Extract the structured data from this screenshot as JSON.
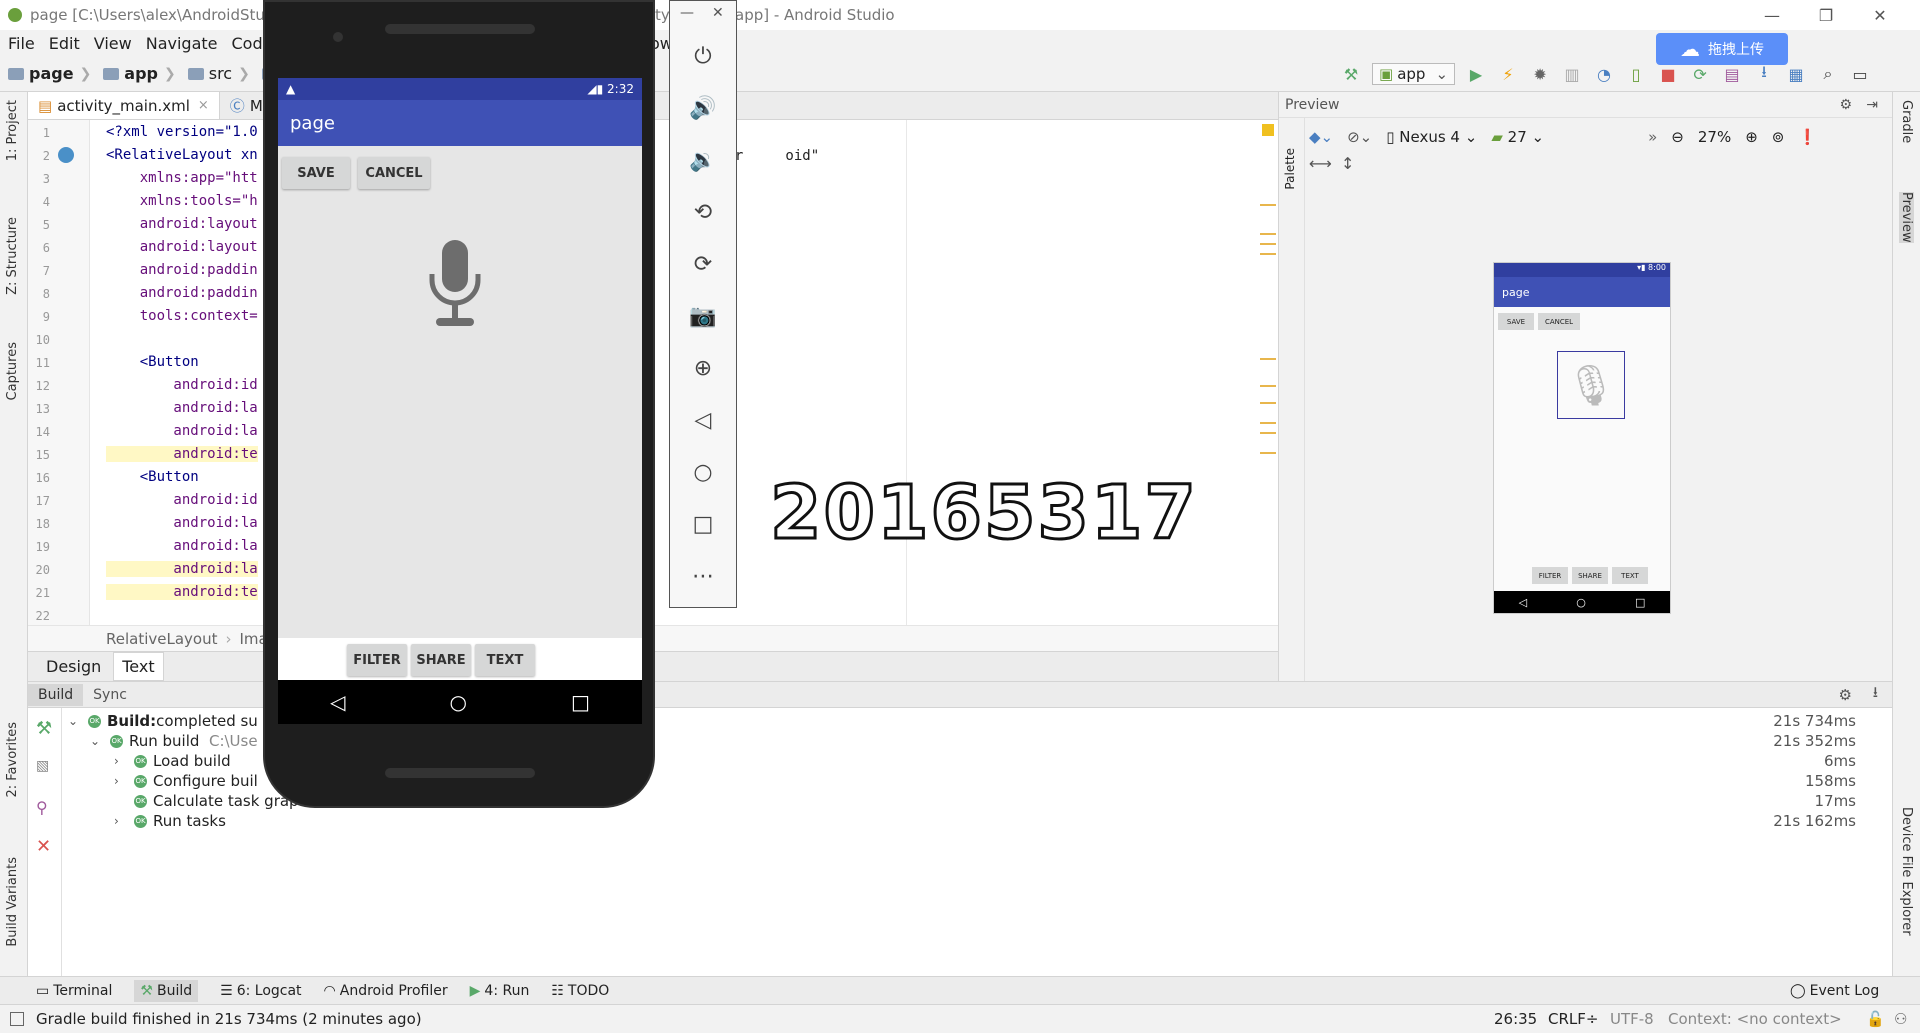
{
  "window": {
    "title": "page [C:\\Users\\alex\\AndroidStudi",
    "title_right": "ty_m",
    "title_tail": "app] - Android Studio"
  },
  "menu": [
    "File",
    "Edit",
    "View",
    "Navigate",
    "Code",
    "ow"
  ],
  "breadcrumb": {
    "project": "page",
    "module": "app",
    "src": "src",
    "m": "m"
  },
  "run_config": "app",
  "upload_button": "拖拽上传",
  "file_tabs": [
    {
      "label": "activity_main.xml",
      "close": "×"
    },
    {
      "label": "Ma"
    }
  ],
  "editor": {
    "line_numbers": [
      "1",
      "2",
      "3",
      "4",
      "5",
      "6",
      "7",
      "8",
      "9",
      "10",
      "11",
      "12",
      "13",
      "14",
      "15",
      "16",
      "17",
      "18",
      "19",
      "20",
      "21",
      "22"
    ],
    "lines": [
      "<?xml version=\"1.0",
      "<RelativeLayout xn",
      "    xmlns:app=\"htt",
      "    xmlns:tools=\"h",
      "    android:layout",
      "    android:layout",
      "    android:paddin",
      "    android:paddin",
      "    tools:context=",
      "",
      "    <Button",
      "        android:id",
      "        android:la",
      "        android:la",
      "        android:te",
      "    <Button",
      "        android:id",
      "        android:la",
      "        android:la",
      "        android:la",
      "        android:te",
      ""
    ],
    "line2_tail": "\"/r     oid\"",
    "bottom_crumbs": [
      "RelativeLayout",
      "Ima"
    ],
    "overlay_text": "20165317"
  },
  "design_tabs": [
    "Design",
    "Text"
  ],
  "preview": {
    "header": "Preview",
    "palette": "Palette",
    "device": "Nexus 4",
    "api": "27",
    "zoom": "27%",
    "more": "»",
    "mini_status_time": "8:00",
    "mini_app_title": "page",
    "mini_buttons_top": [
      "SAVE",
      "CANCEL"
    ],
    "mini_buttons_bottom": [
      "FILTER",
      "SHARE",
      "TEXT"
    ]
  },
  "build": {
    "tabs": [
      "Build",
      "Sync"
    ],
    "rows": [
      {
        "bold": "Build:",
        "text": " completed su",
        "time": "21s 734ms"
      },
      {
        "text": "Run build",
        "extra": "C:\\Use",
        "time": "21s 352ms"
      },
      {
        "text": "Load build",
        "time": "6ms"
      },
      {
        "text": "Configure buil",
        "time": "158ms"
      },
      {
        "text": "Calculate task grap",
        "time": "17ms"
      },
      {
        "text": "Run tasks",
        "time": "21s 162ms"
      }
    ]
  },
  "bottom_tools": [
    "Terminal",
    "Build",
    "6: Logcat",
    "Android Profiler",
    "4: Run",
    "TODO"
  ],
  "event_log": "Event Log",
  "status": {
    "message": "Gradle build finished in 21s 734ms (2 minutes ago)",
    "position": "26:35",
    "line_sep": "CRLF",
    "encoding": "UTF-8",
    "context": "Context: <no context>"
  },
  "left_tabs": [
    "1: Project",
    "Z: Structure",
    "Captures",
    "2: Favorites",
    "Build Variants"
  ],
  "right_tabs": [
    "Gradle",
    "Preview",
    "Device File Explorer"
  ],
  "phone": {
    "status_time": "2:32",
    "app_title": "page",
    "top_buttons": [
      "SAVE",
      "CANCEL"
    ],
    "bottom_buttons": [
      "FILTER",
      "SHARE",
      "TEXT"
    ]
  },
  "colors": {
    "primary": "#3f51b5",
    "primary_dark": "#303f9f",
    "ok_green": "#59a869"
  }
}
